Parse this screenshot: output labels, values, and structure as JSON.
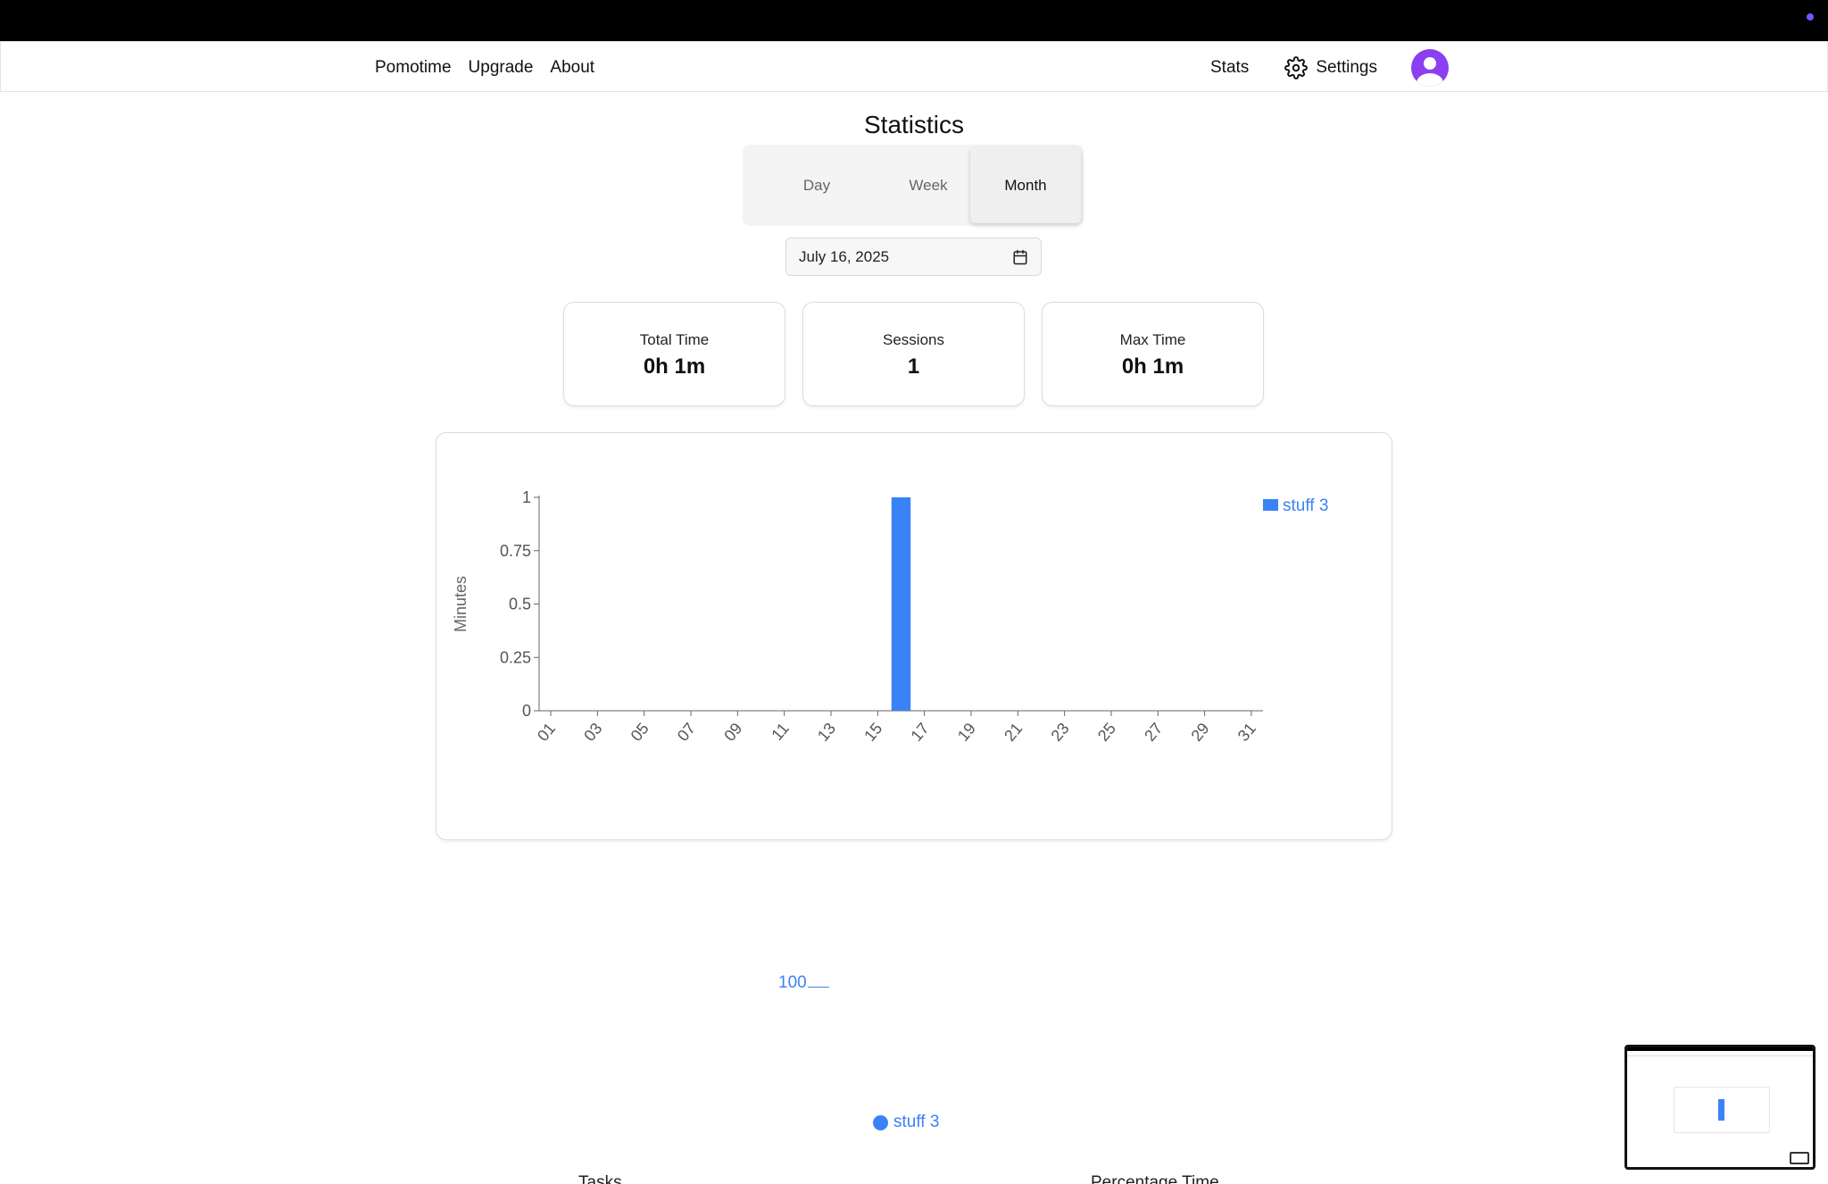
{
  "nav": {
    "left": [
      "Pomotime",
      "Upgrade",
      "About"
    ],
    "stats": "Stats",
    "settings": "Settings"
  },
  "page": {
    "title": "Statistics"
  },
  "range_tabs": {
    "items": [
      "Day",
      "Week",
      "Month"
    ],
    "active": "Month"
  },
  "date_picker": {
    "value": "July 16, 2025"
  },
  "summary": [
    {
      "label": "Total Time",
      "value": "0h 1m"
    },
    {
      "label": "Sessions",
      "value": "1"
    },
    {
      "label": "Max Time",
      "value": "0h 1m"
    }
  ],
  "colors": {
    "accent": "#3b82f6",
    "avatar": "#8b3ff0"
  },
  "chart_data": {
    "type": "bar",
    "ylabel": "Minutes",
    "ylim": [
      0,
      1
    ],
    "yticks": [
      "0",
      "0.25",
      "0.5",
      "0.75",
      "1"
    ],
    "xtick_labels": [
      "01",
      "03",
      "05",
      "07",
      "09",
      "11",
      "13",
      "15",
      "17",
      "19",
      "21",
      "23",
      "25",
      "27",
      "29",
      "31"
    ],
    "series": [
      {
        "name": "stuff 3",
        "x": [
          16
        ],
        "values": [
          1
        ]
      }
    ],
    "days": 31,
    "legend": "top-right",
    "grid": false
  },
  "pie_chart": {
    "slice_label": "100",
    "legend": "stuff 3"
  },
  "cut_off": {
    "left": "Tasks",
    "right": "Percentage Time"
  }
}
